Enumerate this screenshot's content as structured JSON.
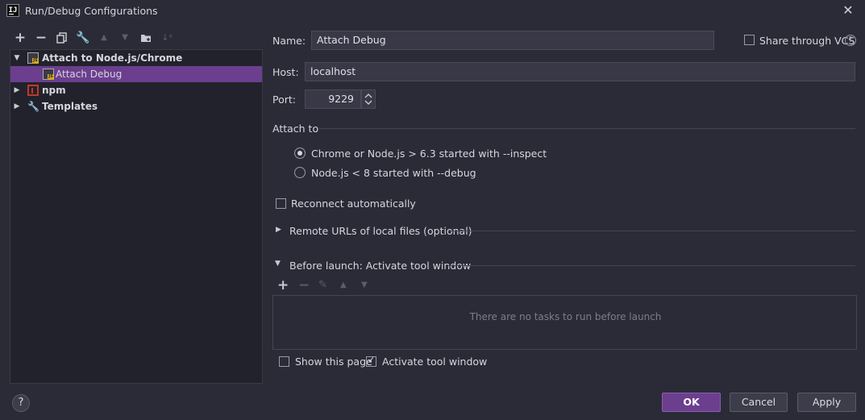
{
  "window": {
    "title": "Run/Debug Configurations",
    "app_icon_text": "IJ"
  },
  "toolbar": {
    "icons": [
      "add-icon",
      "remove-icon",
      "copy-icon",
      "wrench-icon",
      "move-up-icon",
      "move-down-icon",
      "new-folder-icon",
      "sort-icon"
    ]
  },
  "tree": {
    "items": [
      {
        "label": "Attach to Node.js/Chrome",
        "expanded": true,
        "bold": true
      },
      {
        "label": "Attach Debug",
        "selected": true
      },
      {
        "label": "npm",
        "expanded": false,
        "bold": true
      },
      {
        "label": "Templates",
        "expanded": false,
        "bold": true
      }
    ]
  },
  "form": {
    "name_label": "Name:",
    "name_value": "Attach Debug",
    "share_label": "Share through VCS",
    "host_label": "Host:",
    "host_value": "localhost",
    "port_label": "Port:",
    "port_value": "9229",
    "attach_to_label": "Attach to",
    "radio_options": [
      {
        "label": "Chrome or Node.js > 6.3 started with --inspect",
        "selected": true
      },
      {
        "label": "Node.js < 8 started with --debug",
        "selected": false
      }
    ],
    "reconnect_label": "Reconnect automatically",
    "remote_urls_label": "Remote URLs of local files (optional)",
    "before_launch_label": "Before launch: Activate tool window",
    "tasks_empty_text": "There are no tasks to run before launch",
    "show_page_label": "Show this page",
    "activate_tool_label": "Activate tool window"
  },
  "buttons": {
    "ok": "OK",
    "cancel": "Cancel",
    "apply": "Apply",
    "help": "?"
  },
  "colors": {
    "background": "#2b2b37",
    "accent": "#6b3f8e",
    "field": "#383846"
  }
}
